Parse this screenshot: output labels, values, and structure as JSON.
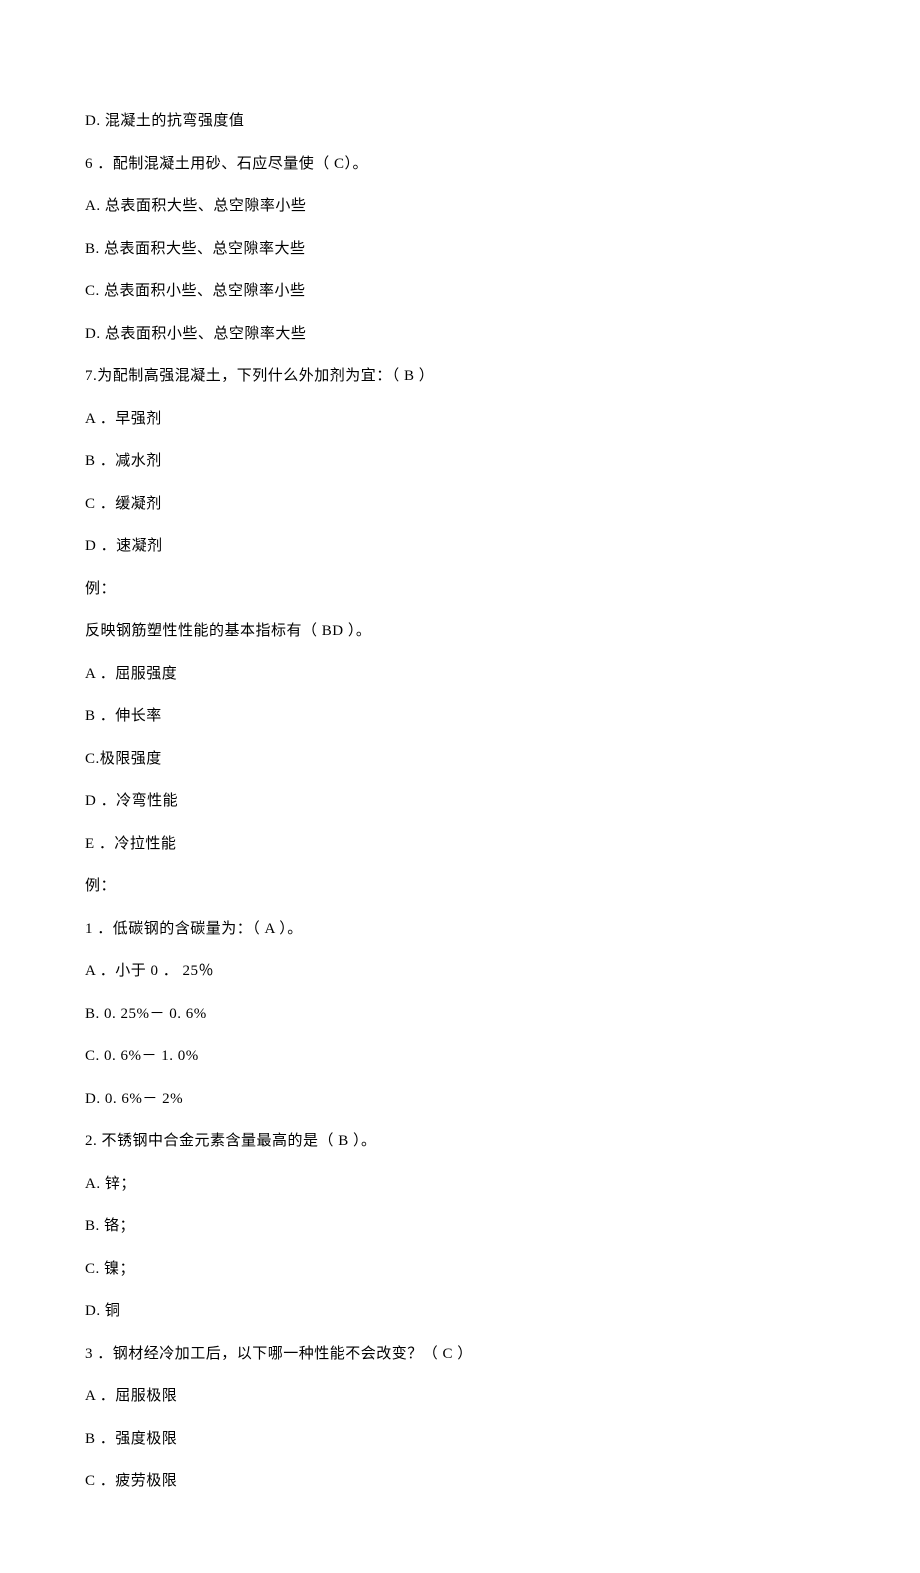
{
  "lines": [
    "D. 混凝土的抗弯强度值",
    "6 ．配制混凝土用砂、石应尽量使（ C）。",
    "A. 总表面积大些、总空隙率小些",
    "B. 总表面积大些、总空隙率大些",
    "C. 总表面积小些、总空隙率小些",
    "D. 总表面积小些、总空隙率大些",
    "7.为配制高强混凝土，下列什么外加剂为宜：（   B ）",
    "A ．早强剂",
    "B ．减水剂",
    "C ．缓凝剂",
    "D ．速凝剂",
    "例：",
    "反映钢筋塑性性能的基本指标有（ BD ）。",
    "A ．屈服强度",
    "B ．伸长率",
    "C.极限强度",
    "D ．冷弯性能",
    "E ．冷拉性能",
    "例：",
    "1 ．低碳钢的含碳量为：（ A ）。",
    "A ．小于 0 ． 25％",
    "B.  0. 25%－ 0. 6%",
    "C.  0.  6%－ 1. 0%",
    "D.  0. 6%－ 2%",
    "2.   不锈钢中合金元素含量最高的是（ B ）。",
    "A. 锌；",
    "B. 铬；",
    "C. 镍；",
    "D. 铜",
    "3 ．钢材经冷加工后，以下哪一种性能不会改变？（   C ）",
    "A ．屈服极限",
    "B ．强度极限",
    "C ．疲劳极限"
  ]
}
